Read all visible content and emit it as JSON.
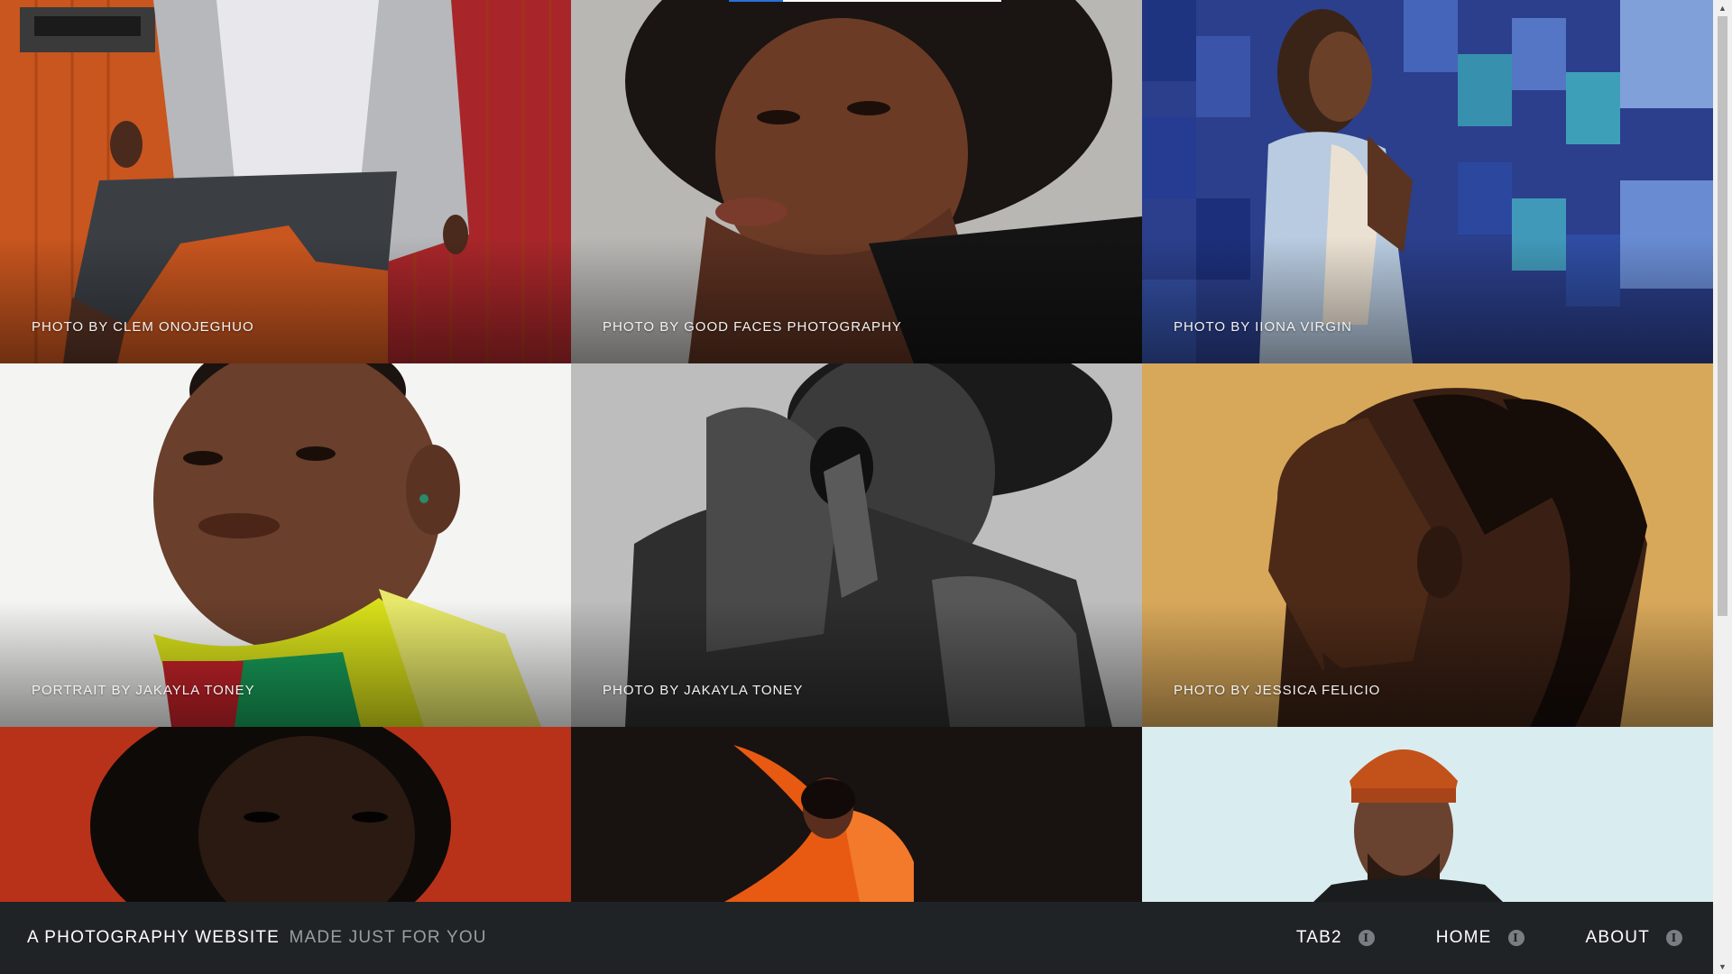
{
  "gallery": {
    "tiles": [
      {
        "caption": "PHOTO BY CLEM ONOJEGHUO"
      },
      {
        "caption": "PHOTO BY GOOD FACES PHOTOGRAPHY"
      },
      {
        "caption": "PHOTO BY IIONA VIRGIN"
      },
      {
        "caption": "PORTRAIT BY JAKAYLA TONEY"
      },
      {
        "caption": "PHOTO BY JAKAYLA TONEY"
      },
      {
        "caption": "PHOTO BY JESSICA FELICIO"
      },
      {
        "caption": ""
      },
      {
        "caption": ""
      },
      {
        "caption": ""
      }
    ]
  },
  "footer": {
    "brand_strong": "A PHOTOGRAPHY WEBSITE",
    "brand_light": "MADE JUST FOR YOU",
    "nav": [
      {
        "label": "TAB2",
        "icon": "info-icon"
      },
      {
        "label": "HOME",
        "icon": "info-icon"
      },
      {
        "label": "ABOUT",
        "icon": "info-icon"
      }
    ]
  },
  "colors": {
    "footer_bg": "#202326",
    "brand_light": "#9a9ea3",
    "indicator_active": "#2a6fd6"
  }
}
